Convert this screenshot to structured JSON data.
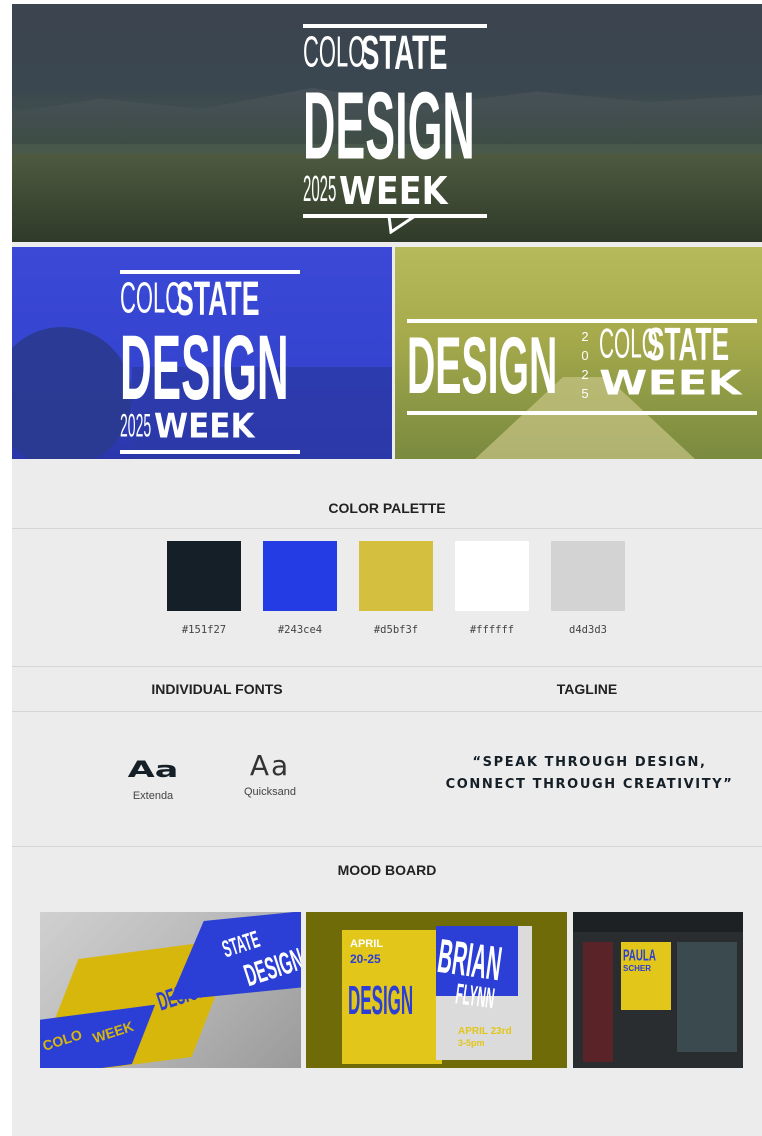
{
  "logo": {
    "colo": "COLO",
    "state": "STATE",
    "design": "DESIGN",
    "year": "2025",
    "week": "WEEK",
    "year_vertical": "2\n0\n2\n5"
  },
  "color_palette": {
    "title": "COLOR PALETTE",
    "swatches": [
      {
        "hex": "#151f27",
        "label": "#151f27"
      },
      {
        "hex": "#243ce4",
        "label": "#243ce4"
      },
      {
        "hex": "#d5bf3f",
        "label": "#d5bf3f"
      },
      {
        "hex": "#ffffff",
        "label": "#ffffff"
      },
      {
        "hex": "#d4d3d3",
        "label": "d4d3d3"
      }
    ]
  },
  "fonts": {
    "title": "INDIVIDUAL FONTS",
    "items": [
      {
        "sample": "Aa",
        "name": "Extenda"
      },
      {
        "sample": "Aa",
        "name": "Quicksand"
      }
    ]
  },
  "tagline": {
    "title": "TAGLINE",
    "line1": "“SPEAK THROUGH DESIGN,",
    "line2": "CONNECT THROUGH CREATIVITY”"
  },
  "mood_board": {
    "title": "MOOD BOARD",
    "mock1": {
      "colo": "COLO",
      "state": "STATE",
      "design": "DESIGN",
      "week": "WEEK"
    },
    "mock2": {
      "date": "APRIL",
      "range": "20-25",
      "name1": "BRIAN",
      "name2": "FLYNN",
      "event": "APRIL 23rd",
      "time": "3-5pm"
    },
    "mock3": {
      "name1": "PAULA",
      "name2": "SCHER"
    }
  }
}
